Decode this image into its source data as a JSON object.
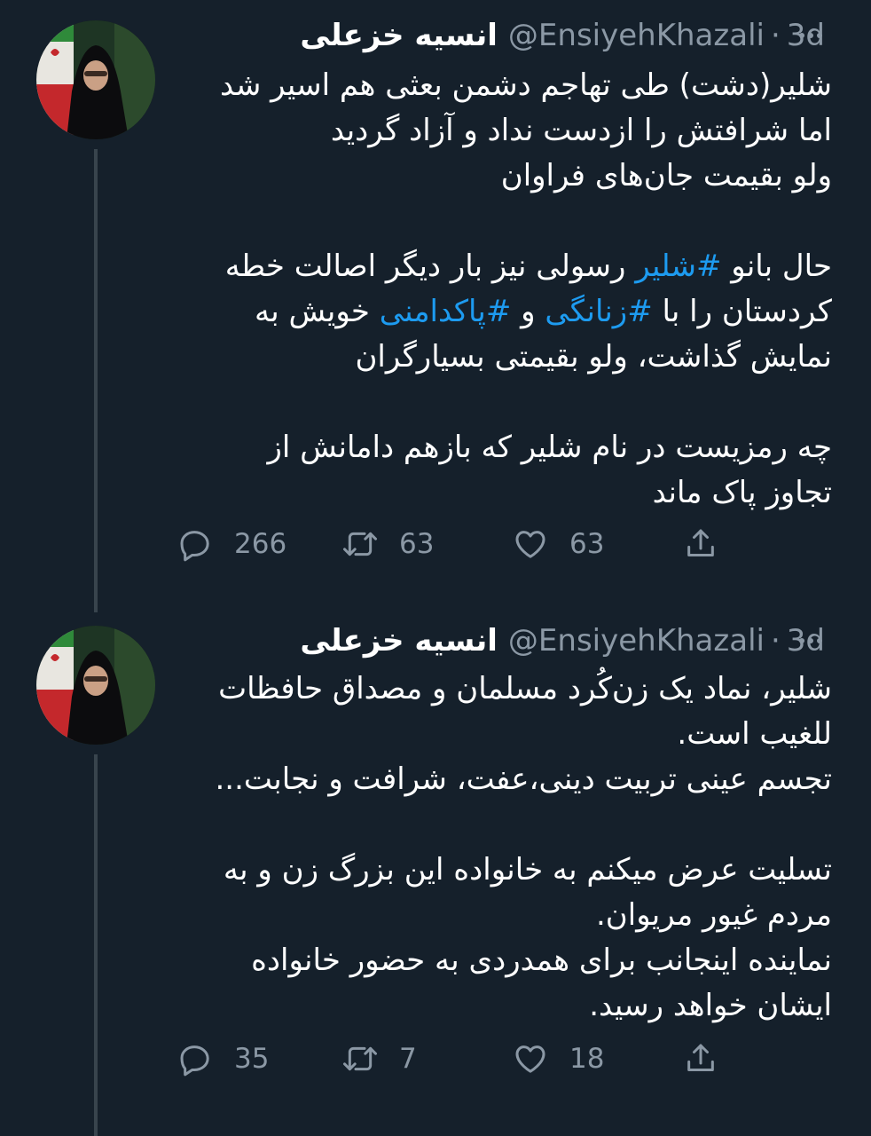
{
  "tweets": [
    {
      "name": "انسیه خزعلی",
      "handle": "@EnsiyehKhazali",
      "time": "3d",
      "lines": [
        "شلیر(دشت) طی تهاجم دشمن بعثی هم اسیر شد",
        "اما شرافتش را ازدست نداد و آزاد گردید",
        "ولو بقیمت جان‌های فراوان",
        "",
        "حال بانو #شلیر رسولی نیز بار دیگر اصالت خطه",
        "کردستان را با #زنانگی و #پاکدامنی خویش به",
        "نمایش گذاشت، ولو بقیمتی بسیارگران",
        "",
        "چه رمزیست در نام شلیر که بازهم دامانش از",
        "تجاوز پاک ماند"
      ],
      "stats": {
        "replies": "266",
        "retweets": "63",
        "likes": "63"
      }
    },
    {
      "name": "انسیه خزعلی",
      "handle": "@EnsiyehKhazali",
      "time": "3d",
      "lines": [
        "شلیر، نماد یک زن‌کُرد مسلمان و مصداق حافظات",
        "للغیب است.",
        "تجسم عینی تربیت دینی،عفت، شرافت و نجابت...",
        "",
        "تسلیت عرض میکنم به خانواده این بزرگ زن و به",
        "مردم غیور مریوان.",
        "نماینده اینجانب برای همدردی به حضور خانواده",
        "ایشان خواهد رسید."
      ],
      "stats": {
        "replies": "35",
        "retweets": "7",
        "likes": "18"
      }
    }
  ],
  "colors": {
    "background": "#15202b",
    "text": "#ffffff",
    "muted": "#8b98a5",
    "hashtag": "#1d9bf0",
    "thread_line": "#38444d"
  },
  "icons": [
    "reply-icon",
    "retweet-icon",
    "like-icon",
    "share-icon",
    "more-icon"
  ]
}
